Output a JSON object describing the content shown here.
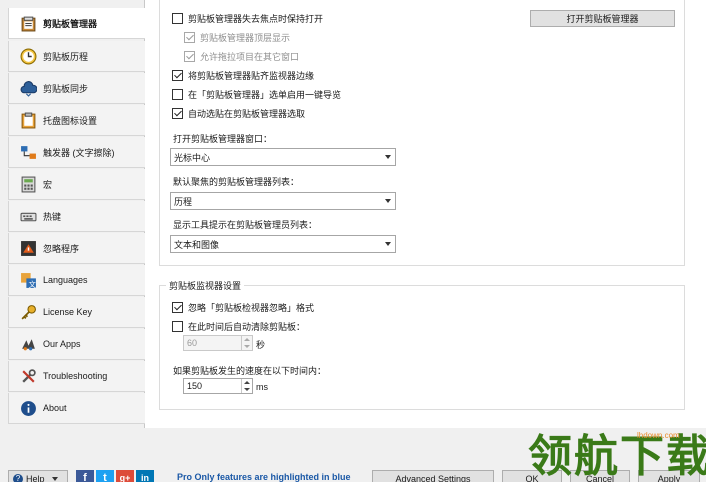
{
  "sidebar": {
    "items": [
      {
        "label": "剪贴板管理器",
        "icon": "clipboard-manager-icon"
      },
      {
        "label": "剪贴板历程",
        "icon": "clock-icon"
      },
      {
        "label": "剪贴板同步",
        "icon": "cloud-sync-icon"
      },
      {
        "label": "托盘图标设置",
        "icon": "clipboard-icon"
      },
      {
        "label": "触发器 (文字擦除)",
        "icon": "trigger-icon"
      },
      {
        "label": "宏",
        "icon": "macro-icon"
      },
      {
        "label": "热键",
        "icon": "keyboard-icon"
      },
      {
        "label": "忽略程序",
        "icon": "ignore-program-icon"
      },
      {
        "label": "Languages",
        "icon": "languages-icon"
      },
      {
        "label": "License Key",
        "icon": "key-icon"
      },
      {
        "label": "Our Apps",
        "icon": "apps-icon"
      },
      {
        "label": "Troubleshooting",
        "icon": "tools-icon"
      },
      {
        "label": "About",
        "icon": "info-icon"
      }
    ]
  },
  "manager": {
    "keep_open": "剪贴板管理器失去焦点时保持打开",
    "on_top": "剪贴板管理器顶层显示",
    "allow_drag": "允许拖拉项目在其它窗口",
    "open_button": "打开剪贴板管理器",
    "snap_edge": "将剪贴板管理器贴齐监视器边缘",
    "enable_nav": "在「剪贴板管理器」选单启用一键导览",
    "auto_select": "自动选贴在剪贴板管理器选取",
    "open_window_label": "打开剪贴板管理器窗口：",
    "open_window_value": "光标中心",
    "default_list_label": "默认聚焦的剪贴板管理器列表：",
    "default_list_value": "历程",
    "tooltip_label": "显示工具提示在剪贴板管理员列表：",
    "tooltip_value": "文本和图像"
  },
  "monitor": {
    "title": "剪贴板监视器设置",
    "ignore_format": "忽略「剪贴板检视器忽略」格式",
    "auto_clear": "在此时间后自动清除剪贴板：",
    "clear_value": "60",
    "clear_unit": "秒",
    "speed_label": "如果剪贴板发生的速度在以下时间内：",
    "speed_value": "150",
    "speed_unit": "ms"
  },
  "states": {
    "keep_open": false,
    "on_top": true,
    "allow_drag": true,
    "snap_edge": true,
    "enable_nav": false,
    "auto_select": true,
    "ignore_format": true,
    "auto_clear": false
  },
  "bottom": {
    "help": "Help",
    "promo": "Pro Only features are highlighted in blue",
    "advanced": "Advanced Settings",
    "ok": "OK",
    "cancel": "Cancel",
    "apply": "Apply"
  },
  "watermark": {
    "text": "领航下载",
    "site": "lhdown.com"
  },
  "colors": {
    "promo": "#1a58a6",
    "facebook": "#3b5998",
    "twitter": "#1da1f2",
    "google": "#dd4b39",
    "linkedin": "#0077b5",
    "watermark": "#3a7a18"
  }
}
